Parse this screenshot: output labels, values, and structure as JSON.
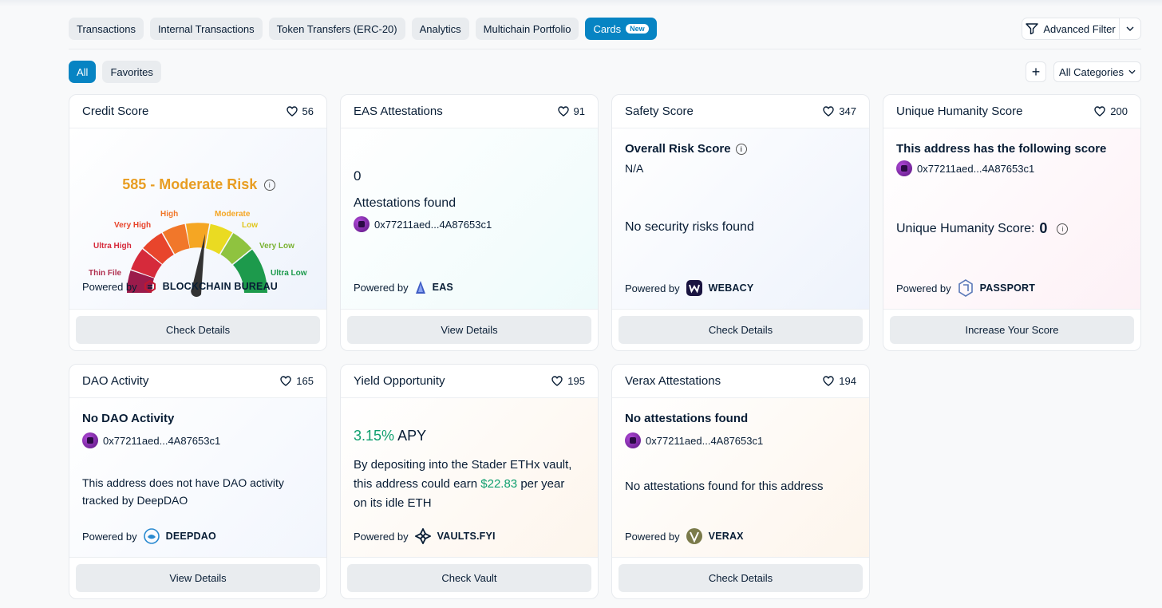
{
  "tabs": [
    "Transactions",
    "Internal Transactions",
    "Token Transfers (ERC-20)",
    "Analytics",
    "Multichain Portfolio",
    "Cards"
  ],
  "tab_badge": "New",
  "advanced_filter": "Advanced Filter",
  "filters": {
    "all": "All",
    "favorites": "Favorites",
    "plus": "+",
    "categories": "All Categories"
  },
  "powered_by": "Powered by",
  "address": "0x77211aed...4A87653c1",
  "colors": {
    "primary": "#0784c3",
    "orange": "#e89d22",
    "green": "#0e9f6e"
  },
  "cards": {
    "credit": {
      "title": "Credit Score",
      "likes": "56",
      "score": "585 - Moderate Risk",
      "gauge_labels": [
        "Thin File",
        "Ultra High",
        "Very High",
        "High",
        "Moderate",
        "Low",
        "Very Low",
        "Ultra Low"
      ],
      "brand": "BLOCKCHAIN BUREAU",
      "button": "Check Details"
    },
    "eas": {
      "title": "EAS Attestations",
      "likes": "91",
      "count": "0",
      "label": "Attestations found",
      "brand": "EAS",
      "button": "View Details"
    },
    "safety": {
      "title": "Safety Score",
      "likes": "347",
      "heading": "Overall Risk Score",
      "value": "N/A",
      "message": "No security risks found",
      "brand": "WEBACY",
      "button": "Check Details"
    },
    "humanity": {
      "title": "Unique Humanity Score",
      "likes": "200",
      "heading": "This address has the following score",
      "score_label": "Unique Humanity Score:",
      "score_value": "0",
      "brand": "PASSPORT",
      "button": "Increase Your Score"
    },
    "dao": {
      "title": "DAO Activity",
      "likes": "165",
      "heading": "No DAO Activity",
      "message_line1": "This address does not have DAO activity",
      "message_line2": "tracked by DeepDAO",
      "brand": "DEEPDAO",
      "button": "View Details"
    },
    "yield": {
      "title": "Yield Opportunity",
      "likes": "195",
      "apy_value": "3.15%",
      "apy_label": "APY",
      "line1": "By depositing into the Stader ETHx vault,",
      "line2_pre": "this address could earn",
      "amount": "$22.83",
      "line2_post": "per year",
      "line3": "on its idle ETH",
      "brand": "VAULTS.FYI",
      "button": "Check Vault"
    },
    "verax": {
      "title": "Verax Attestations",
      "likes": "194",
      "heading": "No attestations found",
      "message": "No attestations found for this address",
      "brand": "VERAX",
      "button": "Check Details"
    }
  }
}
